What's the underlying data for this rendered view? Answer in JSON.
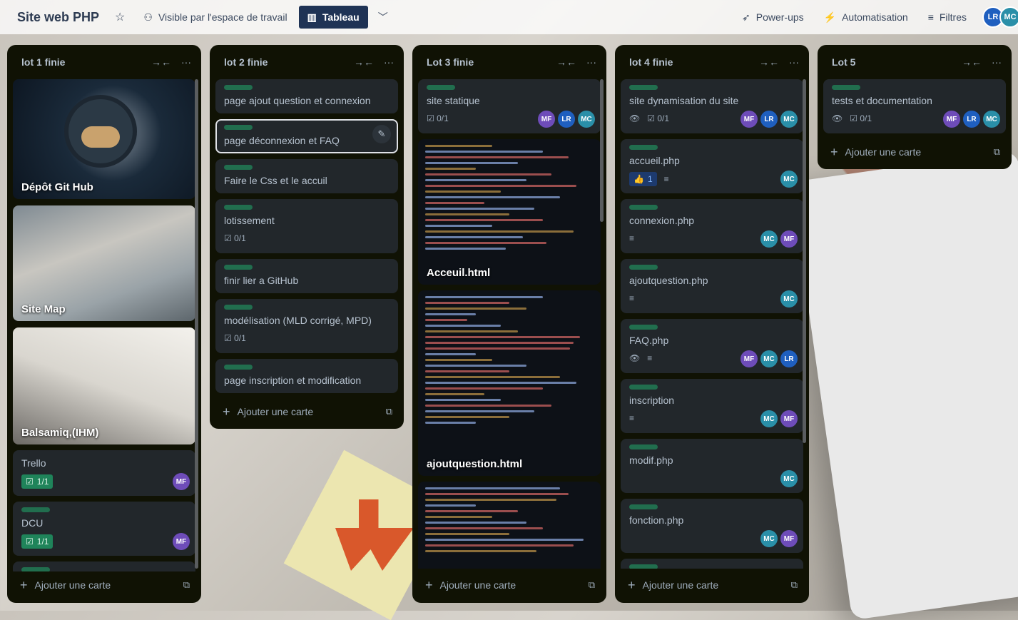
{
  "board": {
    "title": "Site web PHP",
    "visibility": "Visible par l'espace de travail",
    "view": "Tableau",
    "actions": {
      "powerups": "Power-ups",
      "automation": "Automatisation",
      "filters": "Filtres"
    },
    "members": [
      "LR",
      "MC"
    ]
  },
  "lists": [
    {
      "title": "lot 1 finie",
      "cards": [
        {
          "title": "Dépôt Git Hub",
          "cover": "github"
        },
        {
          "title": "Site Map",
          "cover": "sitemap"
        },
        {
          "title": "Balsamiq,(IHM)",
          "cover": "balsamiq"
        },
        {
          "title": "Trello",
          "checklist": "1/1",
          "members": [
            "MF"
          ]
        },
        {
          "title": "DCU",
          "checklist": "1/1",
          "members": [
            "MF"
          ]
        }
      ],
      "add_label": "Ajouter une carte"
    },
    {
      "title": "lot 2 finie",
      "cards": [
        {
          "title": "page ajout question et connexion"
        },
        {
          "title": "page déconnexion et FAQ"
        },
        {
          "title": "Faire le Css et le accuil"
        },
        {
          "title": "lotissement",
          "checklist": "0/1"
        },
        {
          "title": "finir lier a GitHub"
        },
        {
          "title": "modélisation (MLD corrigé, MPD)",
          "checklist": "0/1"
        },
        {
          "title": "page inscription et modification"
        }
      ],
      "add_label": "Ajouter une carte"
    },
    {
      "title": "Lot 3 finie",
      "cards": [
        {
          "title": "site statique",
          "checklist": "0/1",
          "members": [
            "MF",
            "LR",
            "MC"
          ]
        },
        {
          "title": "Acceuil.html",
          "cover": "code"
        },
        {
          "title": "ajoutquestion.html",
          "cover": "code"
        }
      ],
      "add_label": "Ajouter une carte"
    },
    {
      "title": "lot 4 finie",
      "cards": [
        {
          "title": "site dynamisation du site",
          "checklist": "0/1",
          "members": [
            "MF",
            "LR",
            "MC"
          ]
        },
        {
          "title": "accueil.php",
          "likes": "1",
          "members": [
            "MC"
          ]
        },
        {
          "title": "connexion.php",
          "members": [
            "MC",
            "MF"
          ]
        },
        {
          "title": "ajoutquestion.php",
          "members": [
            "MC"
          ]
        },
        {
          "title": "FAQ.php",
          "members": [
            "MF",
            "MC",
            "LR"
          ]
        },
        {
          "title": "inscription",
          "members": [
            "MC",
            "MF"
          ]
        },
        {
          "title": "modif.php",
          "members": [
            "MC"
          ]
        },
        {
          "title": "fonction.php",
          "members": [
            "MC",
            "MF"
          ]
        }
      ],
      "add_label": "Ajouter une carte"
    },
    {
      "title": "Lot 5",
      "cards": [
        {
          "title": "tests et documentation",
          "checklist": "0/1",
          "members": [
            "MF",
            "LR",
            "MC"
          ]
        }
      ],
      "add_label": "Ajouter une carte"
    }
  ],
  "colors": {
    "list_bg": "#101204",
    "card_bg": "#22272b",
    "label_green": "#216e4e",
    "header_btn": "#1f3355"
  }
}
